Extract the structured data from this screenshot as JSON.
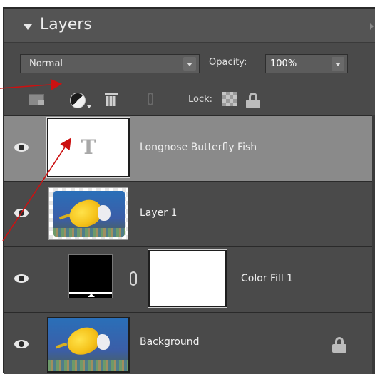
{
  "panel": {
    "title": "Layers"
  },
  "blend": {
    "mode": "Normal",
    "opacity_label": "Opacity:",
    "opacity_value": "100%"
  },
  "toolbar": {
    "lock_label": "Lock:"
  },
  "layers": [
    {
      "name": "Longnose Butterfly Fish",
      "type": "text",
      "selected": true,
      "visible": true,
      "text_thumb": "T"
    },
    {
      "name": "Layer 1",
      "type": "image",
      "selected": false,
      "visible": true
    },
    {
      "name": "Color Fill 1",
      "type": "fill",
      "selected": false,
      "visible": true
    },
    {
      "name": "Background",
      "type": "image",
      "selected": false,
      "visible": true,
      "locked": true
    }
  ],
  "colors": {
    "panel_bg": "#4a4a4a",
    "selected_row": "#8a8a8a",
    "annotation_arrow": "#cc1111"
  }
}
